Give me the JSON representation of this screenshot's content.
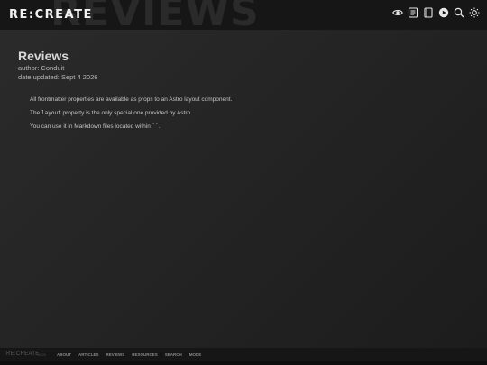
{
  "header": {
    "logo": "RE:CREATE",
    "background_word": "REVIEWS",
    "icons": [
      "eye-icon",
      "document-icon",
      "notebook-icon",
      "play-icon",
      "search-icon",
      "sun-icon"
    ]
  },
  "article": {
    "title": "Reviews",
    "author": "author: Conduit",
    "date": "date updated: Sept 4 2026",
    "paragraphs": {
      "p1": "All frontmatter properties are available as props to an Astro layout component.",
      "p2_before": "The ",
      "p2_code": "layout",
      "p2_after": " property is the only special one provided by Astro.",
      "p3_before": "You can use it in Markdown files located within ",
      "p3_code": "``",
      "p3_after": "."
    }
  },
  "footer": {
    "logo": "RE:CREATE",
    "year": "2026",
    "nav": [
      "ABOUT",
      "ARTICLES",
      "REVIEWS",
      "RESOURCES",
      "SEARCH",
      "MODE"
    ]
  },
  "colors": {
    "header_bg": "#161616",
    "page_bg": "#252525",
    "text": "#c4c4c4"
  }
}
